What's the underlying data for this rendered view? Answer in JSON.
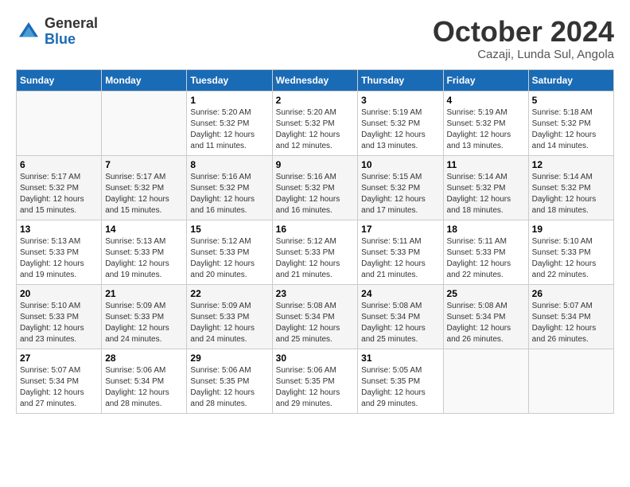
{
  "logo": {
    "general": "General",
    "blue": "Blue"
  },
  "header": {
    "month": "October 2024",
    "location": "Cazaji, Lunda Sul, Angola"
  },
  "weekdays": [
    "Sunday",
    "Monday",
    "Tuesday",
    "Wednesday",
    "Thursday",
    "Friday",
    "Saturday"
  ],
  "weeks": [
    [
      {
        "day": "",
        "sunrise": "",
        "sunset": "",
        "daylight": ""
      },
      {
        "day": "",
        "sunrise": "",
        "sunset": "",
        "daylight": ""
      },
      {
        "day": "1",
        "sunrise": "Sunrise: 5:20 AM",
        "sunset": "Sunset: 5:32 PM",
        "daylight": "Daylight: 12 hours and 11 minutes."
      },
      {
        "day": "2",
        "sunrise": "Sunrise: 5:20 AM",
        "sunset": "Sunset: 5:32 PM",
        "daylight": "Daylight: 12 hours and 12 minutes."
      },
      {
        "day": "3",
        "sunrise": "Sunrise: 5:19 AM",
        "sunset": "Sunset: 5:32 PM",
        "daylight": "Daylight: 12 hours and 13 minutes."
      },
      {
        "day": "4",
        "sunrise": "Sunrise: 5:19 AM",
        "sunset": "Sunset: 5:32 PM",
        "daylight": "Daylight: 12 hours and 13 minutes."
      },
      {
        "day": "5",
        "sunrise": "Sunrise: 5:18 AM",
        "sunset": "Sunset: 5:32 PM",
        "daylight": "Daylight: 12 hours and 14 minutes."
      }
    ],
    [
      {
        "day": "6",
        "sunrise": "Sunrise: 5:17 AM",
        "sunset": "Sunset: 5:32 PM",
        "daylight": "Daylight: 12 hours and 15 minutes."
      },
      {
        "day": "7",
        "sunrise": "Sunrise: 5:17 AM",
        "sunset": "Sunset: 5:32 PM",
        "daylight": "Daylight: 12 hours and 15 minutes."
      },
      {
        "day": "8",
        "sunrise": "Sunrise: 5:16 AM",
        "sunset": "Sunset: 5:32 PM",
        "daylight": "Daylight: 12 hours and 16 minutes."
      },
      {
        "day": "9",
        "sunrise": "Sunrise: 5:16 AM",
        "sunset": "Sunset: 5:32 PM",
        "daylight": "Daylight: 12 hours and 16 minutes."
      },
      {
        "day": "10",
        "sunrise": "Sunrise: 5:15 AM",
        "sunset": "Sunset: 5:32 PM",
        "daylight": "Daylight: 12 hours and 17 minutes."
      },
      {
        "day": "11",
        "sunrise": "Sunrise: 5:14 AM",
        "sunset": "Sunset: 5:32 PM",
        "daylight": "Daylight: 12 hours and 18 minutes."
      },
      {
        "day": "12",
        "sunrise": "Sunrise: 5:14 AM",
        "sunset": "Sunset: 5:32 PM",
        "daylight": "Daylight: 12 hours and 18 minutes."
      }
    ],
    [
      {
        "day": "13",
        "sunrise": "Sunrise: 5:13 AM",
        "sunset": "Sunset: 5:33 PM",
        "daylight": "Daylight: 12 hours and 19 minutes."
      },
      {
        "day": "14",
        "sunrise": "Sunrise: 5:13 AM",
        "sunset": "Sunset: 5:33 PM",
        "daylight": "Daylight: 12 hours and 19 minutes."
      },
      {
        "day": "15",
        "sunrise": "Sunrise: 5:12 AM",
        "sunset": "Sunset: 5:33 PM",
        "daylight": "Daylight: 12 hours and 20 minutes."
      },
      {
        "day": "16",
        "sunrise": "Sunrise: 5:12 AM",
        "sunset": "Sunset: 5:33 PM",
        "daylight": "Daylight: 12 hours and 21 minutes."
      },
      {
        "day": "17",
        "sunrise": "Sunrise: 5:11 AM",
        "sunset": "Sunset: 5:33 PM",
        "daylight": "Daylight: 12 hours and 21 minutes."
      },
      {
        "day": "18",
        "sunrise": "Sunrise: 5:11 AM",
        "sunset": "Sunset: 5:33 PM",
        "daylight": "Daylight: 12 hours and 22 minutes."
      },
      {
        "day": "19",
        "sunrise": "Sunrise: 5:10 AM",
        "sunset": "Sunset: 5:33 PM",
        "daylight": "Daylight: 12 hours and 22 minutes."
      }
    ],
    [
      {
        "day": "20",
        "sunrise": "Sunrise: 5:10 AM",
        "sunset": "Sunset: 5:33 PM",
        "daylight": "Daylight: 12 hours and 23 minutes."
      },
      {
        "day": "21",
        "sunrise": "Sunrise: 5:09 AM",
        "sunset": "Sunset: 5:33 PM",
        "daylight": "Daylight: 12 hours and 24 minutes."
      },
      {
        "day": "22",
        "sunrise": "Sunrise: 5:09 AM",
        "sunset": "Sunset: 5:33 PM",
        "daylight": "Daylight: 12 hours and 24 minutes."
      },
      {
        "day": "23",
        "sunrise": "Sunrise: 5:08 AM",
        "sunset": "Sunset: 5:34 PM",
        "daylight": "Daylight: 12 hours and 25 minutes."
      },
      {
        "day": "24",
        "sunrise": "Sunrise: 5:08 AM",
        "sunset": "Sunset: 5:34 PM",
        "daylight": "Daylight: 12 hours and 25 minutes."
      },
      {
        "day": "25",
        "sunrise": "Sunrise: 5:08 AM",
        "sunset": "Sunset: 5:34 PM",
        "daylight": "Daylight: 12 hours and 26 minutes."
      },
      {
        "day": "26",
        "sunrise": "Sunrise: 5:07 AM",
        "sunset": "Sunset: 5:34 PM",
        "daylight": "Daylight: 12 hours and 26 minutes."
      }
    ],
    [
      {
        "day": "27",
        "sunrise": "Sunrise: 5:07 AM",
        "sunset": "Sunset: 5:34 PM",
        "daylight": "Daylight: 12 hours and 27 minutes."
      },
      {
        "day": "28",
        "sunrise": "Sunrise: 5:06 AM",
        "sunset": "Sunset: 5:34 PM",
        "daylight": "Daylight: 12 hours and 28 minutes."
      },
      {
        "day": "29",
        "sunrise": "Sunrise: 5:06 AM",
        "sunset": "Sunset: 5:35 PM",
        "daylight": "Daylight: 12 hours and 28 minutes."
      },
      {
        "day": "30",
        "sunrise": "Sunrise: 5:06 AM",
        "sunset": "Sunset: 5:35 PM",
        "daylight": "Daylight: 12 hours and 29 minutes."
      },
      {
        "day": "31",
        "sunrise": "Sunrise: 5:05 AM",
        "sunset": "Sunset: 5:35 PM",
        "daylight": "Daylight: 12 hours and 29 minutes."
      },
      {
        "day": "",
        "sunrise": "",
        "sunset": "",
        "daylight": ""
      },
      {
        "day": "",
        "sunrise": "",
        "sunset": "",
        "daylight": ""
      }
    ]
  ]
}
